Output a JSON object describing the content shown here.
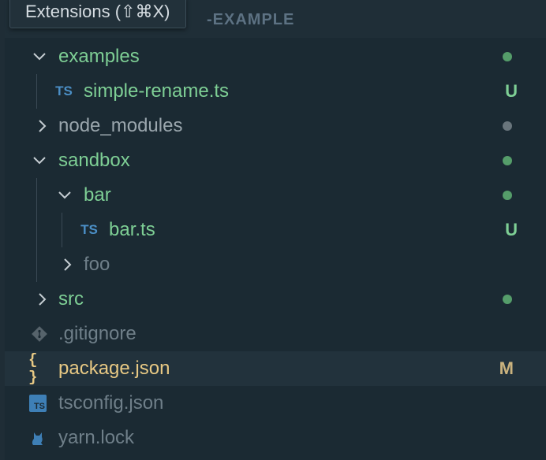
{
  "tooltip": "Extensions (⇧⌘X)",
  "section_header": "-EXAMPLE",
  "tree": {
    "examples": {
      "label": "examples"
    },
    "simple_rename": {
      "label": "simple-rename.ts",
      "icon": "TS",
      "status": "U"
    },
    "node_modules": {
      "label": "node_modules"
    },
    "sandbox": {
      "label": "sandbox"
    },
    "bar_folder": {
      "label": "bar"
    },
    "bar_ts": {
      "label": "bar.ts",
      "icon": "TS",
      "status": "U"
    },
    "foo": {
      "label": "foo"
    },
    "src": {
      "label": "src"
    },
    "gitignore": {
      "label": ".gitignore"
    },
    "package_json": {
      "label": "package.json",
      "icon": "{ }",
      "status": "M"
    },
    "tsconfig": {
      "label": "tsconfig.json",
      "icon": "TS"
    },
    "yarn_lock": {
      "label": "yarn.lock"
    }
  },
  "colors": {
    "background": "#1b2a33",
    "untracked": "#7ecf95",
    "modified": "#e8c984",
    "ts_icon": "#4b8fc6"
  }
}
